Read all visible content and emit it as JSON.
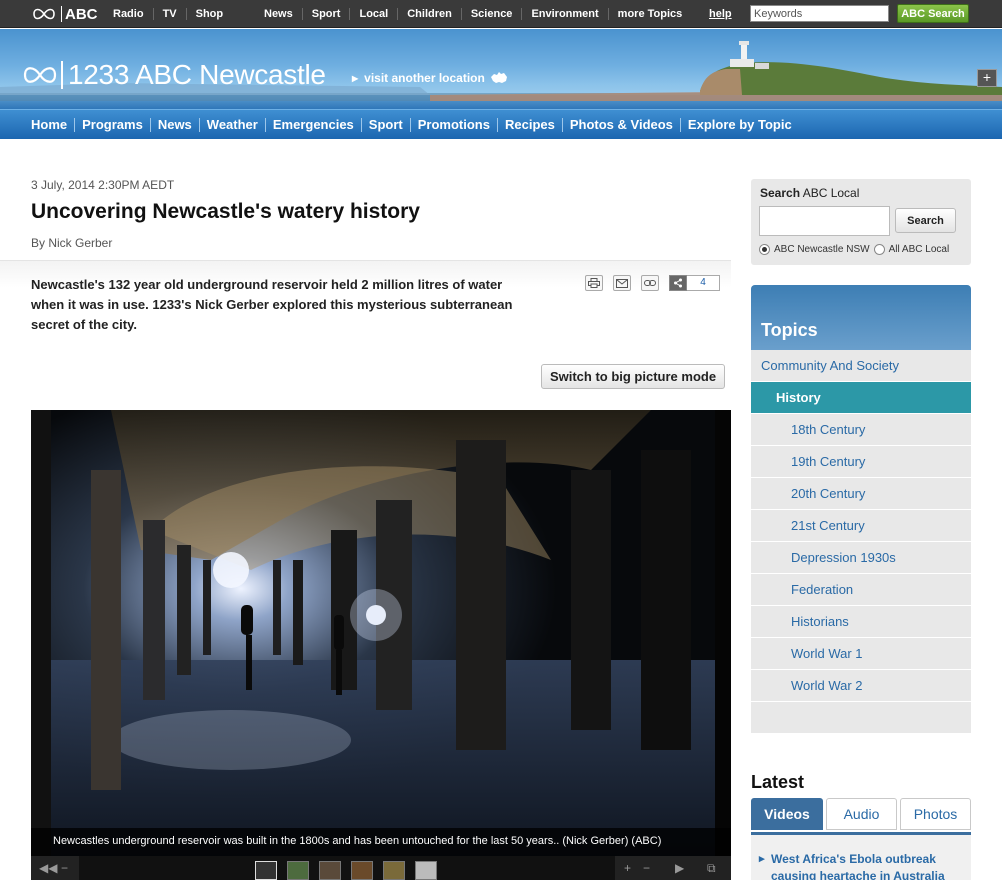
{
  "topbar": {
    "logo_text": "ABC",
    "links_left": [
      "Radio",
      "TV",
      "Shop"
    ],
    "links_mid": [
      "News",
      "Sport",
      "Local",
      "Children",
      "Science",
      "Environment",
      "more Topics"
    ],
    "help": "help",
    "keywords_placeholder": "Keywords",
    "search_button": "ABC Search"
  },
  "banner": {
    "station_name": "1233 ABC Newcastle",
    "visit_link": "visit another location",
    "expand_icon": "+"
  },
  "nav": {
    "items": [
      "Home",
      "Programs",
      "News",
      "Weather",
      "Emergencies",
      "Sport",
      "Promotions",
      "Recipes",
      "Photos & Videos",
      "Explore by Topic"
    ]
  },
  "article": {
    "date": "3 July, 2014 2:30PM AEDT",
    "title": "Uncovering Newcastle's watery history",
    "byline": "By Nick Gerber",
    "summary": "Newcastle's 132 year old underground reservoir held 2 million litres of water when it was in use. 1233's Nick Gerber explored this mysterious subterranean secret of the city.",
    "share_count": "4",
    "switch_button": "Switch to big picture mode",
    "caption": "Newcastles underground reservoir was built in the 1800s and has been untouched for the last 50 years.. (Nick Gerber) (ABC)"
  },
  "sidebar_search": {
    "label_bold": "Search",
    "label_rest": " ABC Local",
    "button": "Search",
    "option1": "ABC Newcastle NSW",
    "option2": "All ABC Local"
  },
  "topics": {
    "heading": "Topics",
    "parent": "Community And Society",
    "selected": "History",
    "children": [
      "18th Century",
      "19th Century",
      "20th Century",
      "21st Century",
      "Depression 1930s",
      "Federation",
      "Historians",
      "World War 1",
      "World War 2"
    ]
  },
  "latest": {
    "heading": "Latest",
    "tabs": [
      "Videos",
      "Audio",
      "Photos"
    ],
    "first_item": "West Africa's Ebola outbreak causing heartache in Australia"
  },
  "colors": {
    "nav_blue": "#1c66b0",
    "topic_selected": "#2c98a7",
    "link_blue": "#2a6aa6",
    "search_green": "#5a9a26"
  }
}
